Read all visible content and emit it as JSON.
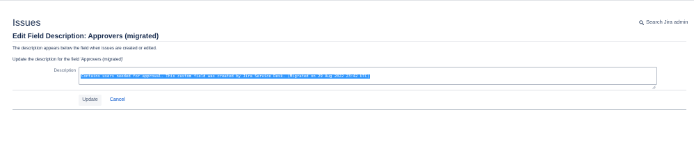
{
  "header": {
    "title": "Issues",
    "search_admin_label": "Search Jira admin",
    "search_icon": "search-icon"
  },
  "form": {
    "title": "Edit Field Description: Approvers (migrated)",
    "help_text": "The description appears below the field when issues are created or edited.",
    "update_instruction": "Update the description for the field 'Approvers (migrated)'",
    "description_label": "Description",
    "description_value": "Contains users needed for approval. This custom field was created by Jira Service Desk. (Migrated on 29 Aug 2022 23:42 UTC)",
    "update_button": "Update",
    "cancel_link": "Cancel"
  },
  "colors": {
    "text": "#172b4d",
    "link": "#0052cc",
    "selection": "#3297fd",
    "button_bg": "#f4f5f7"
  }
}
